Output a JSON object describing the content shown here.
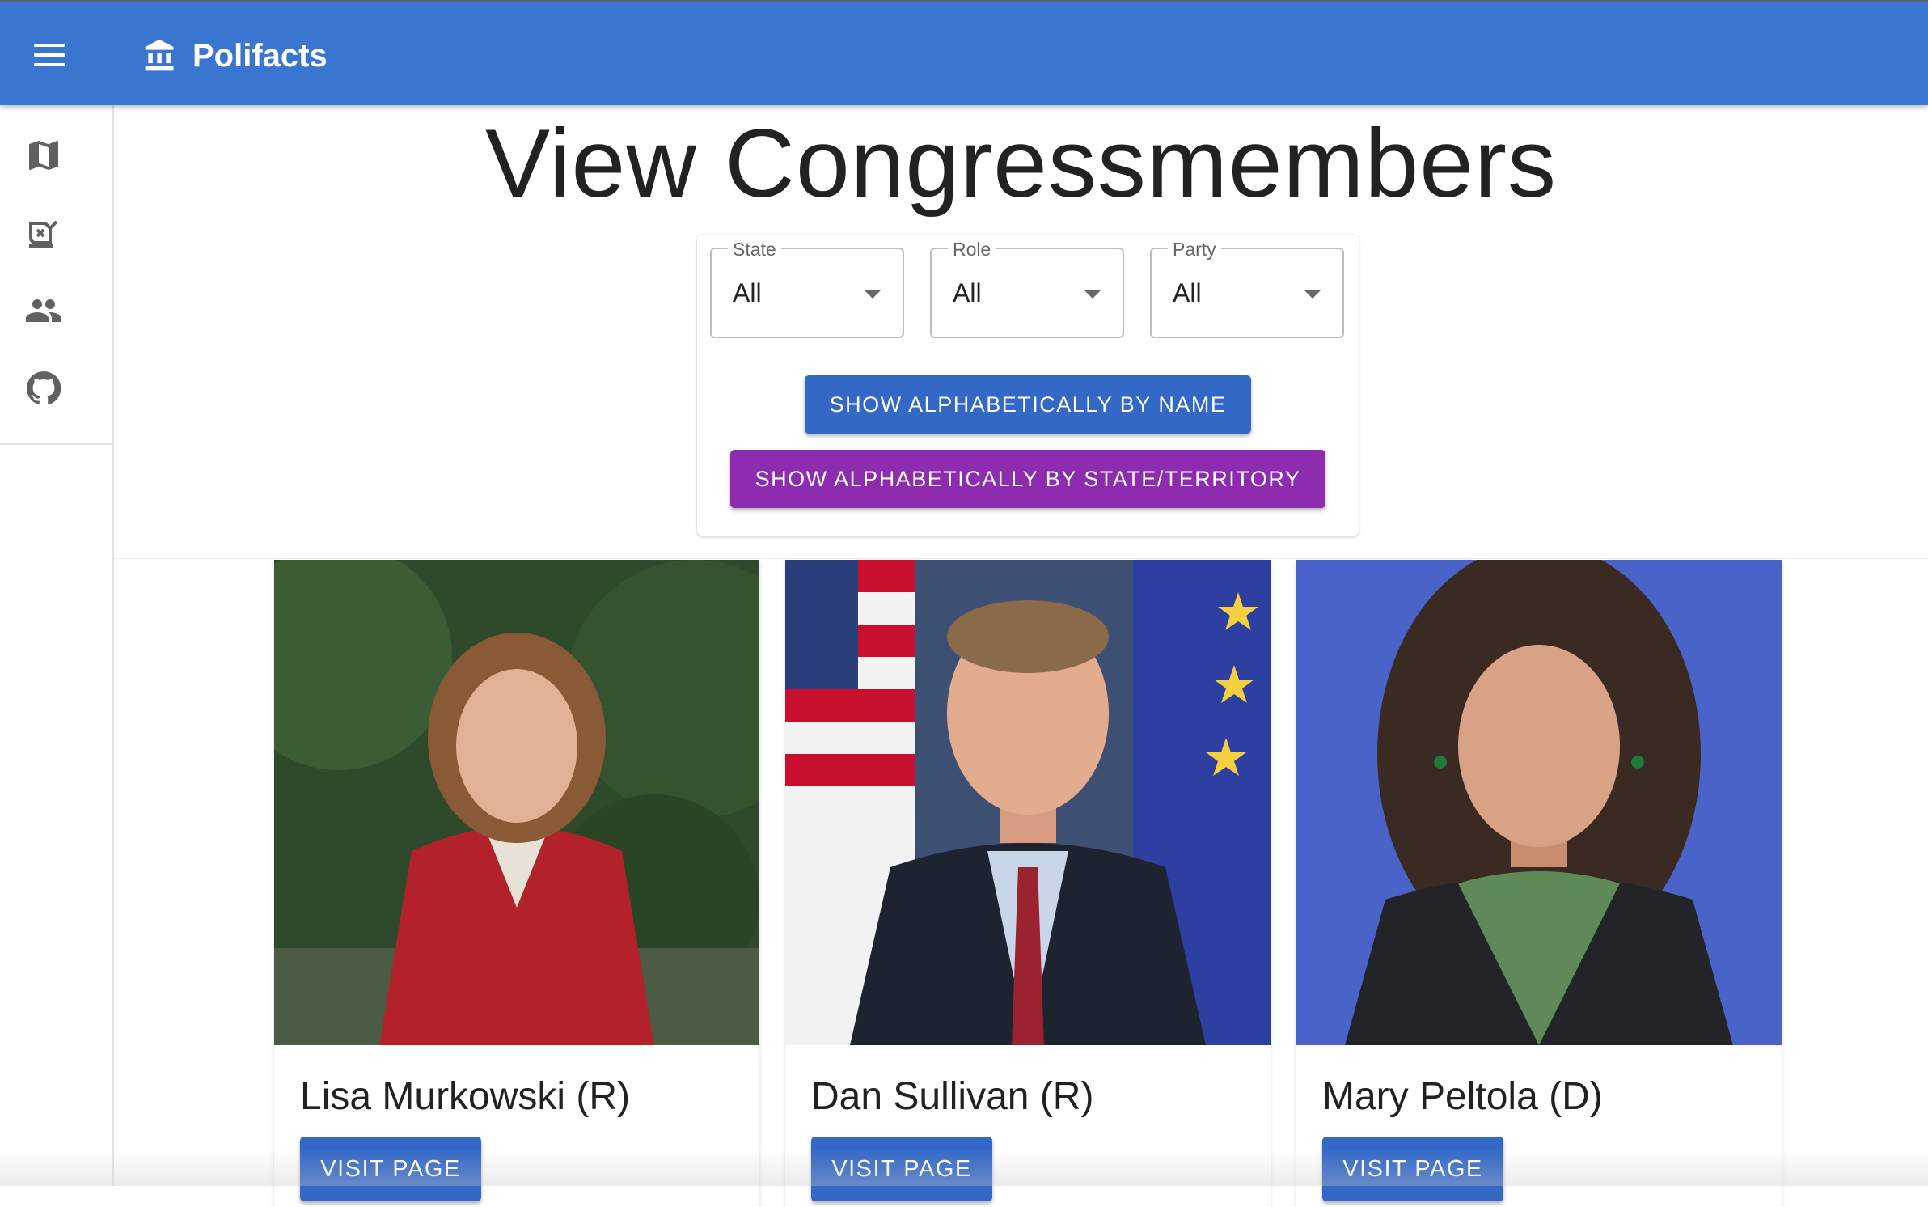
{
  "app": {
    "title": "Polifacts"
  },
  "nav": {
    "items": [
      {
        "icon": "map-icon"
      },
      {
        "icon": "legislation-icon"
      },
      {
        "icon": "people-icon"
      },
      {
        "icon": "github-icon"
      }
    ]
  },
  "page": {
    "title": "View Congressmembers"
  },
  "filters": {
    "state": {
      "label": "State",
      "value": "All"
    },
    "role": {
      "label": "Role",
      "value": "All"
    },
    "party": {
      "label": "Party",
      "value": "All"
    }
  },
  "sort_buttons": {
    "by_name": "SHOW ALPHABETICALLY BY NAME",
    "by_state": "SHOW ALPHABETICALLY BY STATE/TERRITORY"
  },
  "colors": {
    "appbar": "#3a76cf",
    "primary": "#3468c7",
    "secondary": "#8e2cb0"
  },
  "members": [
    {
      "name": "Lisa Murkowski (R)",
      "button": "VISIT PAGE"
    },
    {
      "name": "Dan Sullivan (R)",
      "button": "VISIT PAGE"
    },
    {
      "name": "Mary Peltola (D)",
      "button": "VISIT PAGE"
    }
  ]
}
